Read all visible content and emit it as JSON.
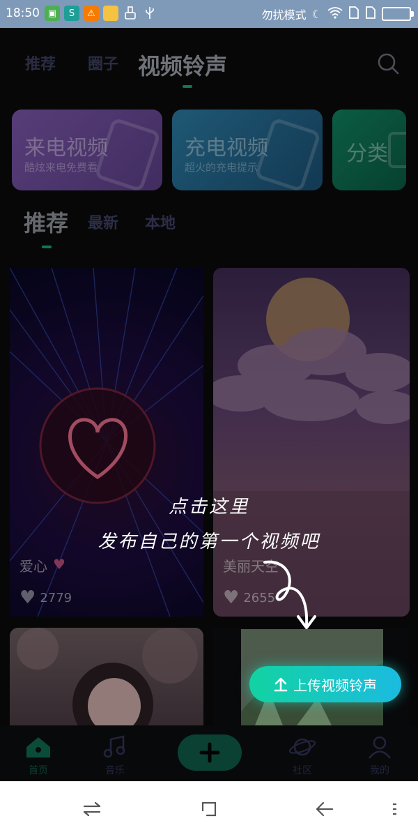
{
  "status_bar": {
    "time": "18:50",
    "dnd_label": "勿扰模式",
    "icons": [
      "app-icon",
      "s-icon",
      "warning-icon",
      "folder-icon",
      "brush-icon",
      "usb-icon"
    ]
  },
  "top_tabs": [
    {
      "label": "推荐",
      "active": false
    },
    {
      "label": "圈子",
      "active": false
    },
    {
      "label": "视频铃声",
      "active": true
    }
  ],
  "categories": [
    {
      "title": "来电视频",
      "subtitle": "酷炫来电免费看",
      "color": "#6d4e97"
    },
    {
      "title": "充电视频",
      "subtitle": "超火的充电提示",
      "color": "#1f5f84"
    },
    {
      "title": "分类",
      "subtitle": "",
      "color": "#0d6a4e"
    }
  ],
  "sub_tabs": [
    {
      "label": "推荐",
      "active": true
    },
    {
      "label": "最新",
      "active": false
    },
    {
      "label": "本地",
      "active": false
    }
  ],
  "videos": [
    {
      "title": "爱心",
      "likes": "2779"
    },
    {
      "title": "美丽天空",
      "likes": "2655"
    },
    {
      "title": "",
      "likes": ""
    },
    {
      "title": "",
      "likes": ""
    }
  ],
  "guide": {
    "line1": "点击这里",
    "line2": "发布自己的第一个视频吧"
  },
  "upload_button": {
    "label": "上传视频铃声"
  },
  "bottom_nav": [
    {
      "label": "首页",
      "icon": "home-icon",
      "active": true
    },
    {
      "label": "音乐",
      "icon": "music-icon",
      "active": false
    },
    {
      "label": "",
      "icon": "plus-icon",
      "active": false
    },
    {
      "label": "社区",
      "icon": "planet-icon",
      "active": false
    },
    {
      "label": "我的",
      "icon": "person-icon",
      "active": false
    }
  ],
  "accent_color": "#18a27a"
}
